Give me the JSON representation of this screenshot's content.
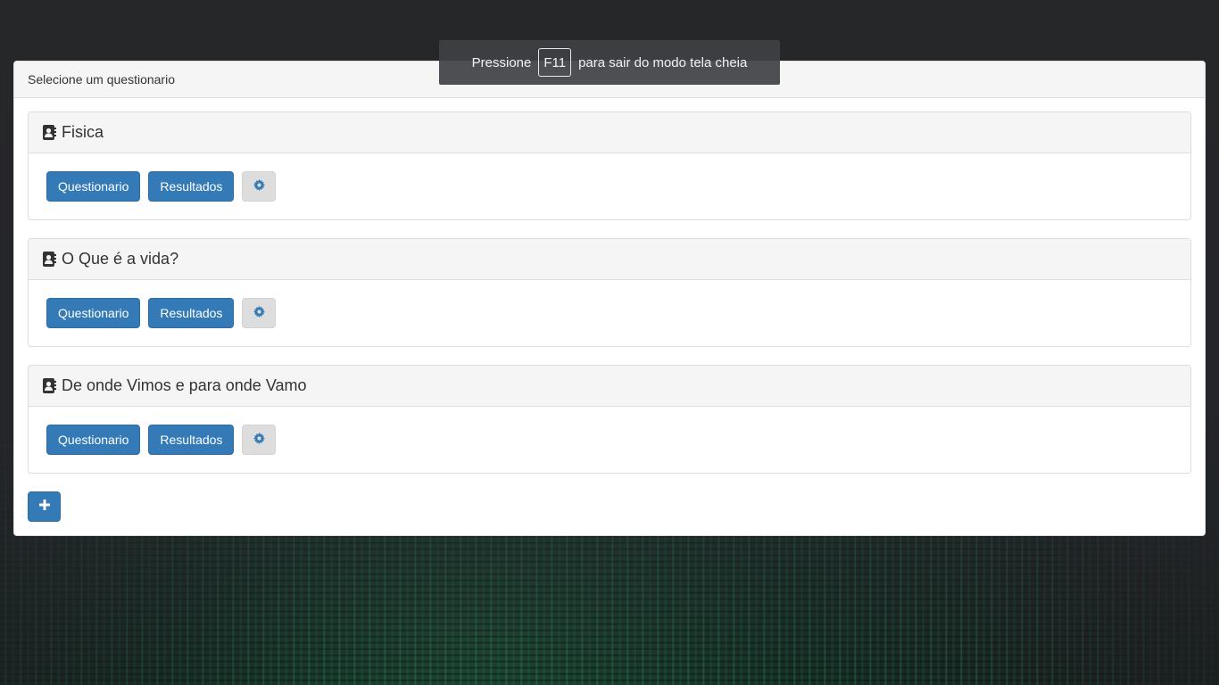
{
  "panel": {
    "heading": "Selecione um questionario"
  },
  "quizzes": [
    {
      "title": "Fisica",
      "questionario_label": "Questionario",
      "resultados_label": "Resultados"
    },
    {
      "title": "O Que é a vida?",
      "questionario_label": "Questionario",
      "resultados_label": "Resultados"
    },
    {
      "title": "De onde Vimos e para onde Vamo",
      "questionario_label": "Questionario",
      "resultados_label": "Resultados"
    }
  ],
  "add_button_icon": "plus-icon",
  "card_icon": "address-book-icon",
  "settings_icon": "gear-icon",
  "fullscreen_toast": {
    "before": "Pressione",
    "key": "F11",
    "after": "para sair do modo tela cheia"
  },
  "colors": {
    "primary": "#337ab7",
    "panel_heading_bg": "#f5f5f5"
  }
}
